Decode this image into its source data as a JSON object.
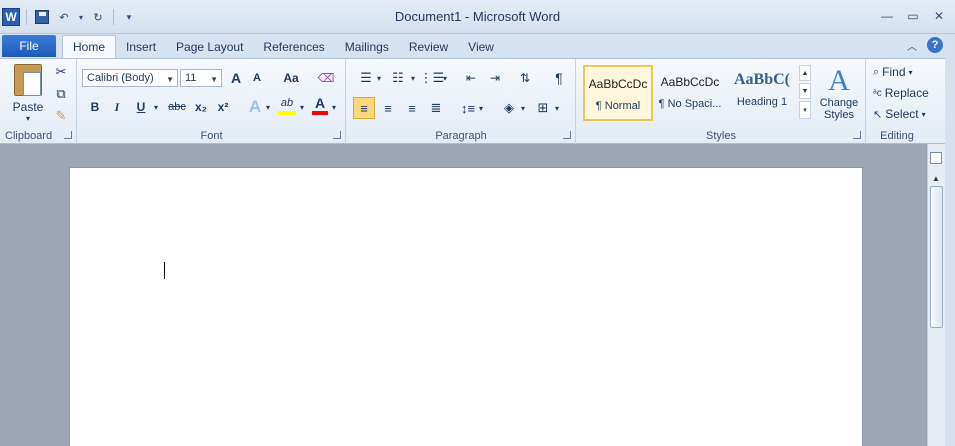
{
  "app": {
    "title": "Document1  -  Microsoft Word",
    "logo_letter": "W"
  },
  "quick_access": {
    "icons": [
      "word-logo-icon",
      "save-icon",
      "undo-icon",
      "redo-icon",
      "customize-qat-icon"
    ]
  },
  "window_controls": [
    "minimize",
    "restore",
    "close"
  ],
  "tabs": {
    "file": "File",
    "items": [
      "Home",
      "Insert",
      "Page Layout",
      "References",
      "Mailings",
      "Review",
      "View"
    ],
    "active": "Home"
  },
  "ribbon": {
    "clipboard": {
      "label": "Clipboard",
      "paste": "Paste"
    },
    "font": {
      "label": "Font",
      "font_name": "Calibri (Body)",
      "font_size": "11",
      "grow": "A",
      "shrink": "A",
      "change_case": "Aa",
      "bold": "B",
      "italic": "I",
      "underline": "U",
      "strikethrough": "abc",
      "subscript": "x₂",
      "superscript": "x²",
      "text_effects": "A",
      "highlight": "ab",
      "font_color": "A"
    },
    "paragraph": {
      "label": "Paragraph"
    },
    "styles": {
      "label": "Styles",
      "items": [
        {
          "sample": "AaBbCcDc",
          "name": "¶ Normal"
        },
        {
          "sample": "AaBbCcDc",
          "name": "¶ No Spaci..."
        },
        {
          "sample": "AaBbC(",
          "name": "Heading 1"
        }
      ],
      "change_styles": "Change Styles"
    },
    "editing": {
      "label": "Editing",
      "find": "Find",
      "replace": "Replace",
      "select": "Select"
    }
  },
  "colors": {
    "file_tab": "#1d5bb8",
    "highlight": "#ffff00",
    "font_color": "#ff0000",
    "selected_style_border": "#f0c558"
  }
}
